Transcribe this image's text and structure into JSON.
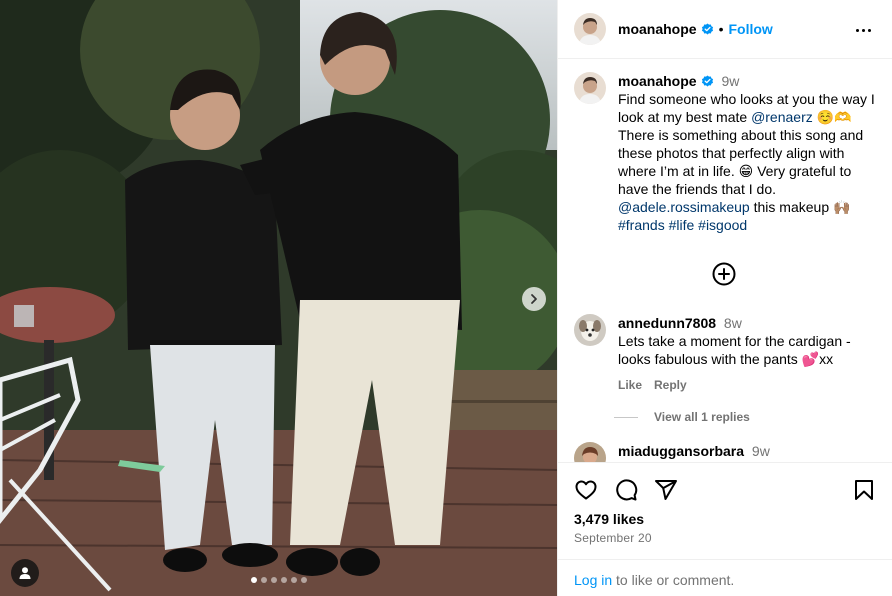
{
  "post": {
    "username": "moanahope",
    "follow_label": "Follow",
    "separator": "•",
    "photo_alt": "Photo by moanahope",
    "carousel_count": 6,
    "carousel_active": 0
  },
  "caption": {
    "username": "moanahope",
    "time": "9w",
    "text_1": "Find someone who looks at you the way I look at my best mate ",
    "mention_1": "@renaerz",
    "emoji_1": " ☺️🫶 ",
    "text_2": "There is something about this song and these photos that perfectly align with where I’m at in life. 😁 Very grateful to have the friends that I do.",
    "mention_2": "@adele.rossimakeup",
    "text_3": " this makeup 🙌🏽",
    "hashtags": "#frands #life #isgood"
  },
  "comments": [
    {
      "username": "annedunn7808",
      "time": "8w",
      "text": "Lets take a moment for the cardigan - looks fabulous with the pants 💕xx",
      "like_label": "Like",
      "reply_label": "Reply",
      "view_replies": "View all 1 replies"
    },
    {
      "username": "miaduggansorbara",
      "time": "9w"
    }
  ],
  "footer": {
    "likes": "3,479 likes",
    "date": "September 20",
    "login_link": "Log in",
    "login_text": " to like or comment."
  },
  "colors": {
    "accent": "#0095f6",
    "link": "#00376b",
    "muted": "#737373",
    "border": "#efefef"
  },
  "icons": [
    "verified-badge-icon",
    "more-options-icon",
    "add-circle-icon",
    "heart-icon",
    "comment-icon",
    "share-icon",
    "bookmark-icon",
    "next-arrow-icon",
    "user-tag-icon"
  ]
}
